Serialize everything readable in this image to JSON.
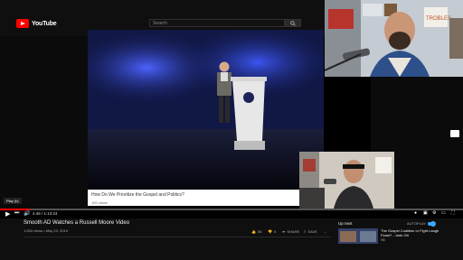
{
  "header": {
    "logo_text": "YouTube",
    "search_placeholder": "Search"
  },
  "slide": {
    "title": "How Do We Prioritize the Gospel and Politics?",
    "views": "100 views"
  },
  "player": {
    "tooltip": "Play (k)",
    "time": "4:46 / 1:13:24",
    "progress_fraction": 0.065
  },
  "video": {
    "title": "Smooth AD Watches a Russell Moore Video",
    "meta": "1,534 views • May 23, 2019",
    "likes": "56",
    "dislikes": "5",
    "share": "SHARE",
    "save": "SAVE",
    "more": "..."
  },
  "sidebar": {
    "up_next": "Up next",
    "autoplay": "AUTOPLAY",
    "next_title": "The Gospel Coalition or Fight Laugh Feast? - Josh Ott",
    "next_channel": "Hili"
  },
  "colors": {
    "brand_red": "#ff0000",
    "stage_blue": "#1a2aa8",
    "accent_blue": "#3ea6ff"
  }
}
